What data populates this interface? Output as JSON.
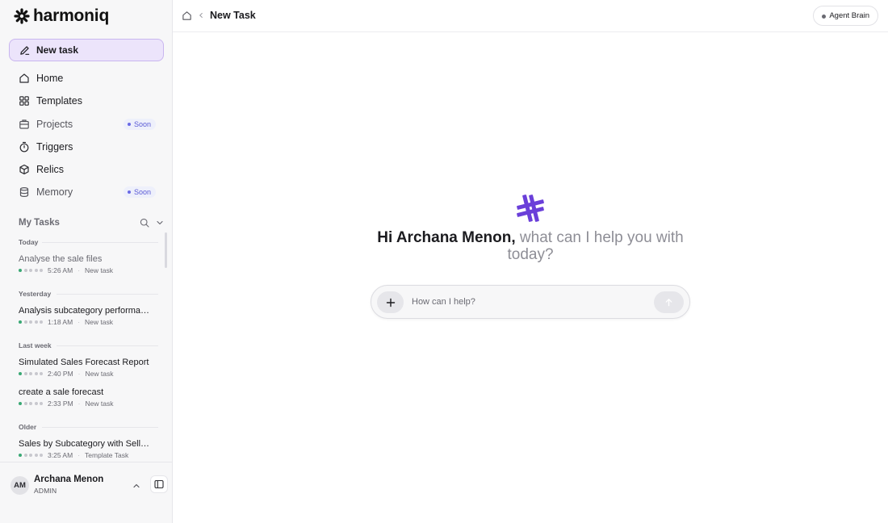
{
  "brand": {
    "name": "harmoniq",
    "logo_icon": "harmoniq-asterisk-icon",
    "accent_color": "#6a3fd9"
  },
  "sidebar": {
    "new_task_label": "New task",
    "nav": [
      {
        "label": "Home",
        "icon": "home-icon",
        "badge": ""
      },
      {
        "label": "Templates",
        "icon": "templates-icon",
        "badge": ""
      },
      {
        "label": "Projects",
        "icon": "projects-icon",
        "badge": "Soon"
      },
      {
        "label": "Triggers",
        "icon": "timer-icon",
        "badge": ""
      },
      {
        "label": "Relics",
        "icon": "cube-icon",
        "badge": ""
      },
      {
        "label": "Memory",
        "icon": "database-icon",
        "badge": "Soon"
      }
    ],
    "my_tasks_label": "My Tasks",
    "groups": [
      {
        "label": "Today",
        "tasks": [
          {
            "title": "Analyse the sale files",
            "time": "5:26 AM",
            "kind": "New task"
          }
        ]
      },
      {
        "label": "Yesterday",
        "tasks": [
          {
            "title": "Analysis subcategory performance",
            "time": "1:18 AM",
            "kind": "New task"
          }
        ]
      },
      {
        "label": "Last week",
        "tasks": [
          {
            "title": "Simulated Sales Forecast Report",
            "time": "2:40 PM",
            "kind": "New task"
          },
          {
            "title": "create a sale forecast",
            "time": "2:33 PM",
            "kind": "New task"
          }
        ]
      },
      {
        "label": "Older",
        "tasks": [
          {
            "title": "Sales by Subcategory with Sell-Through",
            "time": "3:25 AM",
            "kind": "Template Task"
          }
        ]
      }
    ],
    "profile": {
      "initials": "AM",
      "name": "Archana Menon",
      "role": "ADMIN"
    }
  },
  "header": {
    "title": "New Task",
    "agent_button": "Agent Brain"
  },
  "main": {
    "greeting_name": "Hi Archana Menon,",
    "greeting_rest": " what can I help you with today?",
    "input_placeholder": "How can I help?"
  }
}
